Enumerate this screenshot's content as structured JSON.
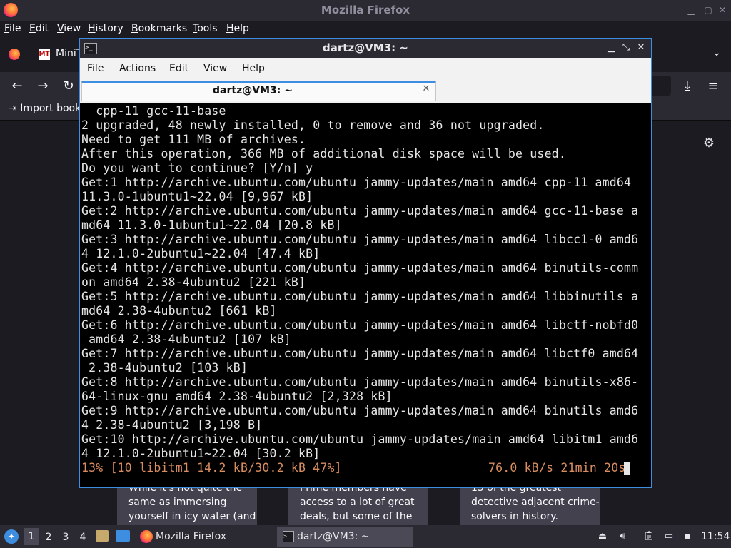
{
  "firefox": {
    "window_title": "Mozilla Firefox",
    "menu": [
      "File",
      "Edit",
      "View",
      "History",
      "Bookmarks",
      "Tools",
      "Help"
    ],
    "tab_label": "MiniT",
    "tab_favicon_text": "MT",
    "bookmarks_import": "Import book",
    "cards": [
      "While it's not quite the same as immersing yourself in icy water (and you won't get t…",
      "Prime members have access to a lot of great deals, but some of the best ones are…",
      "15 of the greatest detective adjacent crime-solvers in history."
    ]
  },
  "terminal": {
    "title": "dartz@VM3: ~",
    "menu": [
      "File",
      "Actions",
      "Edit",
      "View",
      "Help"
    ],
    "tab_label": "dartz@VM3: ~",
    "lines": [
      "  cpp-11 gcc-11-base",
      "2 upgraded, 48 newly installed, 0 to remove and 36 not upgraded.",
      "Need to get 111 MB of archives.",
      "After this operation, 366 MB of additional disk space will be used.",
      "Do you want to continue? [Y/n] y",
      "Get:1 http://archive.ubuntu.com/ubuntu jammy-updates/main amd64 cpp-11 amd64",
      "11.3.0-1ubuntu1~22.04 [9,967 kB]",
      "Get:2 http://archive.ubuntu.com/ubuntu jammy-updates/main amd64 gcc-11-base a",
      "md64 11.3.0-1ubuntu1~22.04 [20.8 kB]",
      "Get:3 http://archive.ubuntu.com/ubuntu jammy-updates/main amd64 libcc1-0 amd6",
      "4 12.1.0-2ubuntu1~22.04 [47.4 kB]",
      "Get:4 http://archive.ubuntu.com/ubuntu jammy-updates/main amd64 binutils-comm",
      "on amd64 2.38-4ubuntu2 [221 kB]",
      "Get:5 http://archive.ubuntu.com/ubuntu jammy-updates/main amd64 libbinutils a",
      "md64 2.38-4ubuntu2 [661 kB]",
      "Get:6 http://archive.ubuntu.com/ubuntu jammy-updates/main amd64 libctf-nobfd0",
      " amd64 2.38-4ubuntu2 [107 kB]",
      "Get:7 http://archive.ubuntu.com/ubuntu jammy-updates/main amd64 libctf0 amd64",
      " 2.38-4ubuntu2 [103 kB]",
      "Get:8 http://archive.ubuntu.com/ubuntu jammy-updates/main amd64 binutils-x86-",
      "64-linux-gnu amd64 2.38-4ubuntu2 [2,328 kB]",
      "Get:9 http://archive.ubuntu.com/ubuntu jammy-updates/main amd64 binutils amd6",
      "4 2.38-4ubuntu2 [3,198 B]",
      "Get:10 http://archive.ubuntu.com/ubuntu jammy-updates/main amd64 libitm1 amd6",
      "4 12.1.0-2ubuntu1~22.04 [30.2 kB]"
    ],
    "status_left": "13% [10 libitm1 14.2 kB/30.2 kB 47%]",
    "status_right": "76.0 kB/s 21min 20s",
    "status_color": "#d98c5f"
  },
  "taskbar": {
    "workspaces": [
      "1",
      "2",
      "3",
      "4"
    ],
    "firefox_label": "Mozilla Firefox",
    "terminal_label": "dartz@VM3: ~",
    "clock": "11:54"
  }
}
